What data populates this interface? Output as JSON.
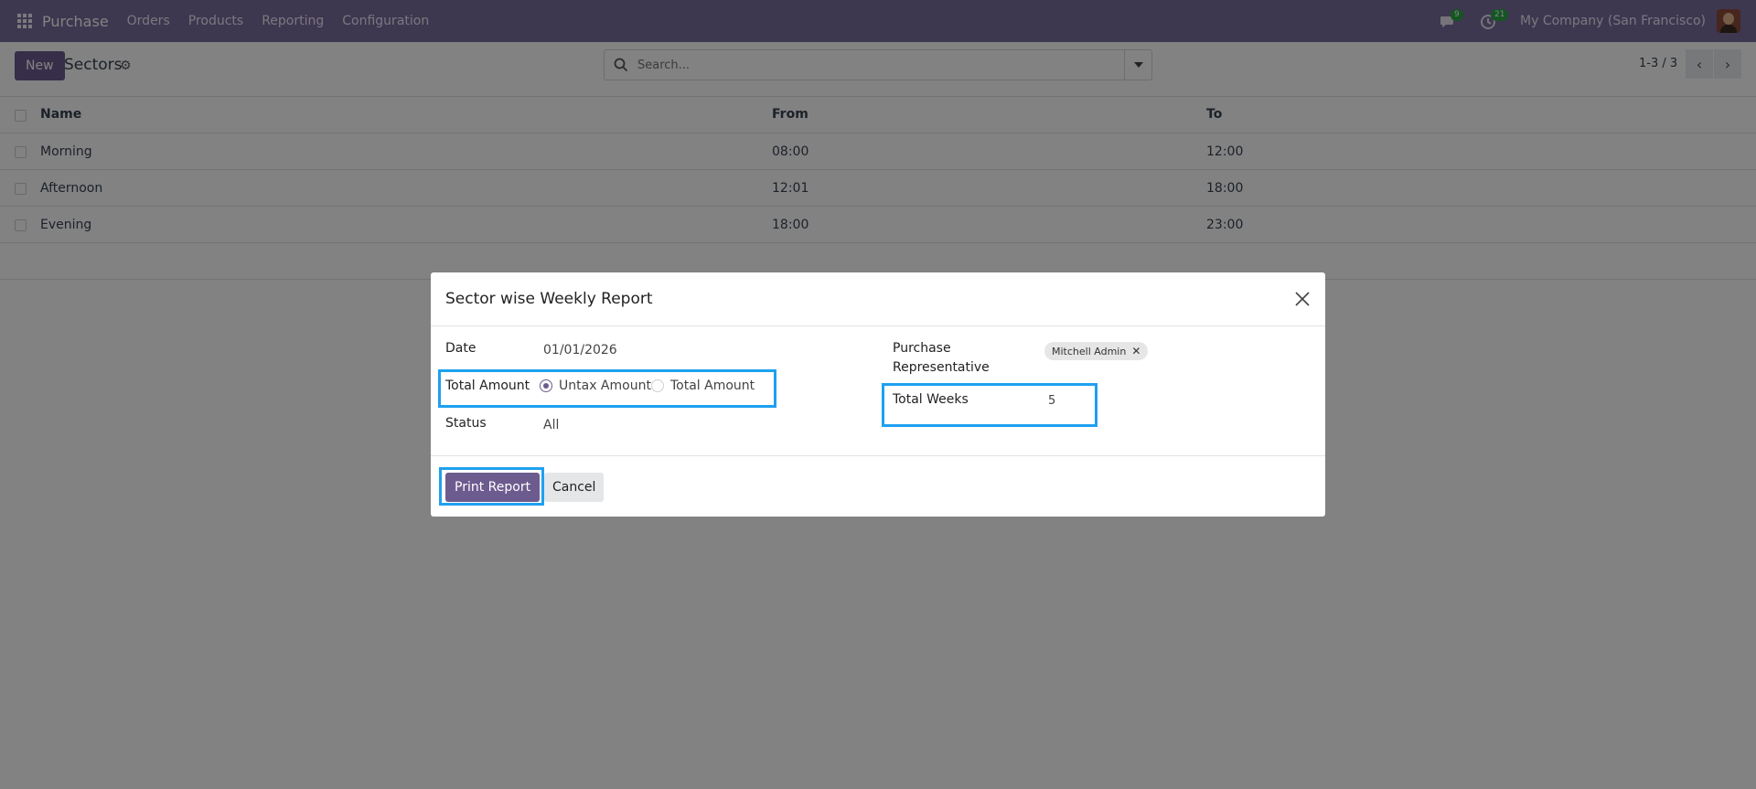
{
  "navbar": {
    "app_name": "Purchase",
    "menu": [
      "Orders",
      "Products",
      "Reporting",
      "Configuration"
    ],
    "messages_count": "9",
    "activities_count": "21",
    "company": "My Company (San Francisco)"
  },
  "control": {
    "new_label": "New",
    "title": "Sectors",
    "search_placeholder": "Search...",
    "pager": "1-3 / 3"
  },
  "list": {
    "columns": [
      "Name",
      "From",
      "To"
    ],
    "rows": [
      {
        "name": "Morning",
        "from": "08:00",
        "to": "12:00"
      },
      {
        "name": "Afternoon",
        "from": "12:01",
        "to": "18:00"
      },
      {
        "name": "Evening",
        "from": "18:00",
        "to": "23:00"
      }
    ]
  },
  "dialog": {
    "title": "Sector wise Weekly Report",
    "date_label": "Date",
    "date_value": "01/01/2026",
    "total_amount_label": "Total Amount",
    "options": [
      "Untax Amount",
      "Total Amount"
    ],
    "selected_option": "Untax Amount",
    "status_label": "Status",
    "status_value": "All",
    "rep_label_line1": "Purchase",
    "rep_label_line2": "Representative",
    "rep_tag": "Mitchell Admin",
    "total_weeks_label": "Total Weeks",
    "total_weeks_value": "5",
    "print_label": "Print Report",
    "cancel_label": "Cancel"
  },
  "colors": {
    "navbar": "#7b6d9e",
    "primary": "#6c5b8f",
    "highlight": "#1ea0f0",
    "badge": "#28a745"
  }
}
